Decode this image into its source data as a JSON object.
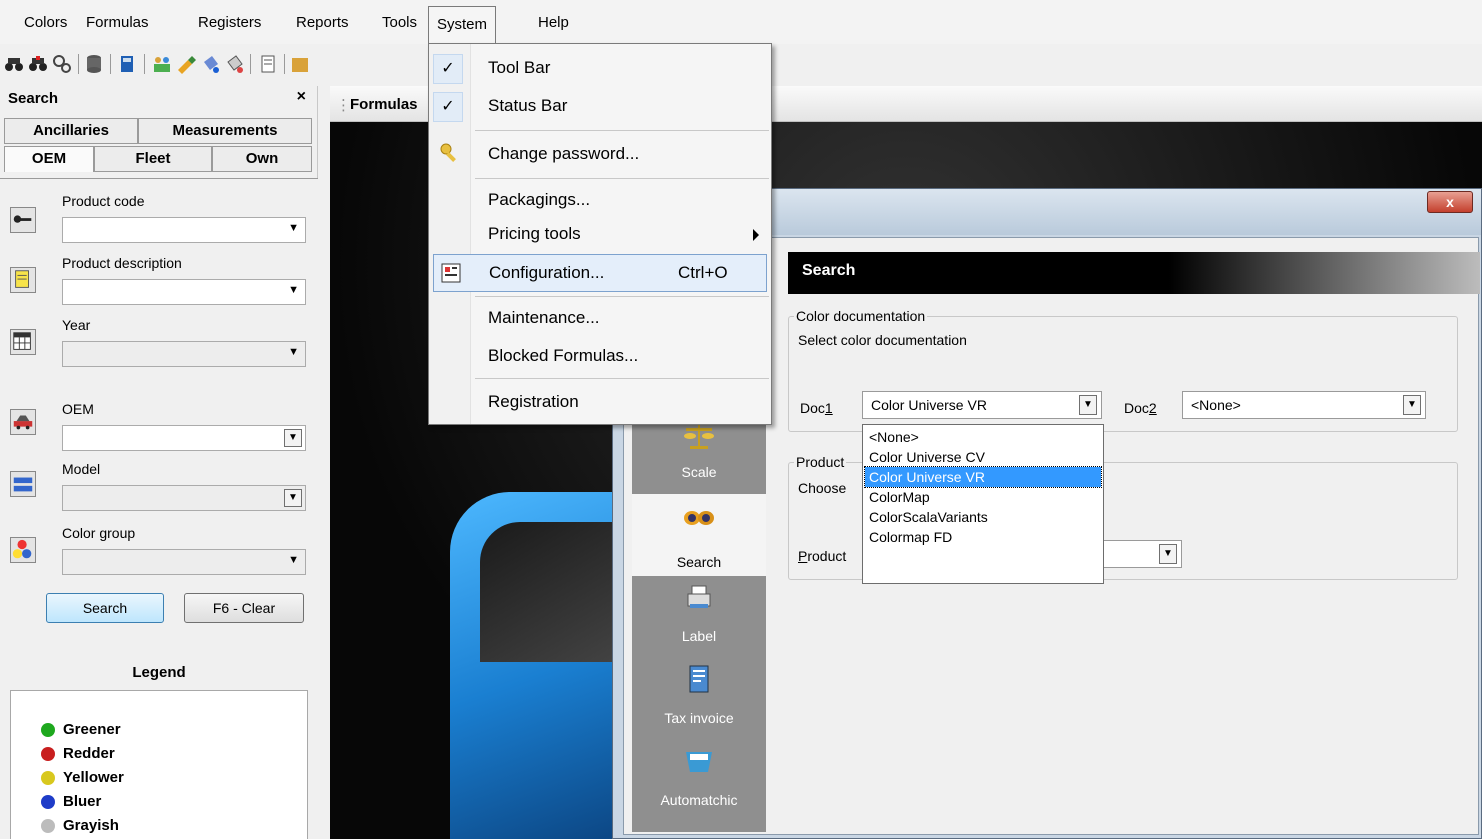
{
  "menubar": {
    "items": [
      "Colors",
      "Formulas",
      "Registers",
      "Reports",
      "Tools",
      "System",
      "Help"
    ]
  },
  "system_menu": {
    "tool_bar": "Tool Bar",
    "status_bar": "Status Bar",
    "change_password": "Change password...",
    "packagings": "Packagings...",
    "pricing_tools": "Pricing tools",
    "configuration": "Configuration...",
    "configuration_shortcut": "Ctrl+O",
    "maintenance": "Maintenance...",
    "blocked_formulas": "Blocked Formulas...",
    "registration": "Registration",
    "check_glyph": "✓"
  },
  "search_panel": {
    "title": "Search",
    "close": "×",
    "tabs_row1": [
      "Ancillaries",
      "Measurements"
    ],
    "tabs_row2": [
      "OEM",
      "Fleet",
      "Own"
    ],
    "fields": {
      "product_code": "Product code",
      "product_description": "Product description",
      "year": "Year",
      "oem": "OEM",
      "model": "Model",
      "color_group": "Color group"
    },
    "search_button": "Search",
    "clear_button": "F6 - Clear",
    "legend_title": "Legend",
    "legend": [
      {
        "label": "Greener",
        "color": "#1ea81e"
      },
      {
        "label": "Redder",
        "color": "#c81e1e"
      },
      {
        "label": "Yellower",
        "color": "#d8c81e"
      },
      {
        "label": "Bluer",
        "color": "#1e3cc8"
      },
      {
        "label": "Grayish",
        "color": "#bcbcbc"
      }
    ]
  },
  "doc_tab": {
    "label": "Formulas"
  },
  "dialog": {
    "close": "x",
    "header": "Search",
    "nav": [
      "Scale",
      "Search",
      "Label",
      "Tax invoice",
      "Automatchic"
    ],
    "color_doc": {
      "group_label": "Color documentation",
      "instruction": "Select color documentation",
      "doc1_prefix": "Doc",
      "doc1_digit": "1",
      "doc1_value": "Color Universe VR",
      "doc2_prefix": "Doc",
      "doc2_digit": "2",
      "doc2_value": "<None>"
    },
    "product": {
      "group_label": "Product",
      "choose": "Choose",
      "product_prefix": "P",
      "product_rest": "roduct"
    },
    "doc1_options": [
      "<None>",
      "Color Universe CV",
      "Color Universe VR",
      "ColorMap",
      "ColorScalaVariants",
      "Colormap FD"
    ]
  }
}
